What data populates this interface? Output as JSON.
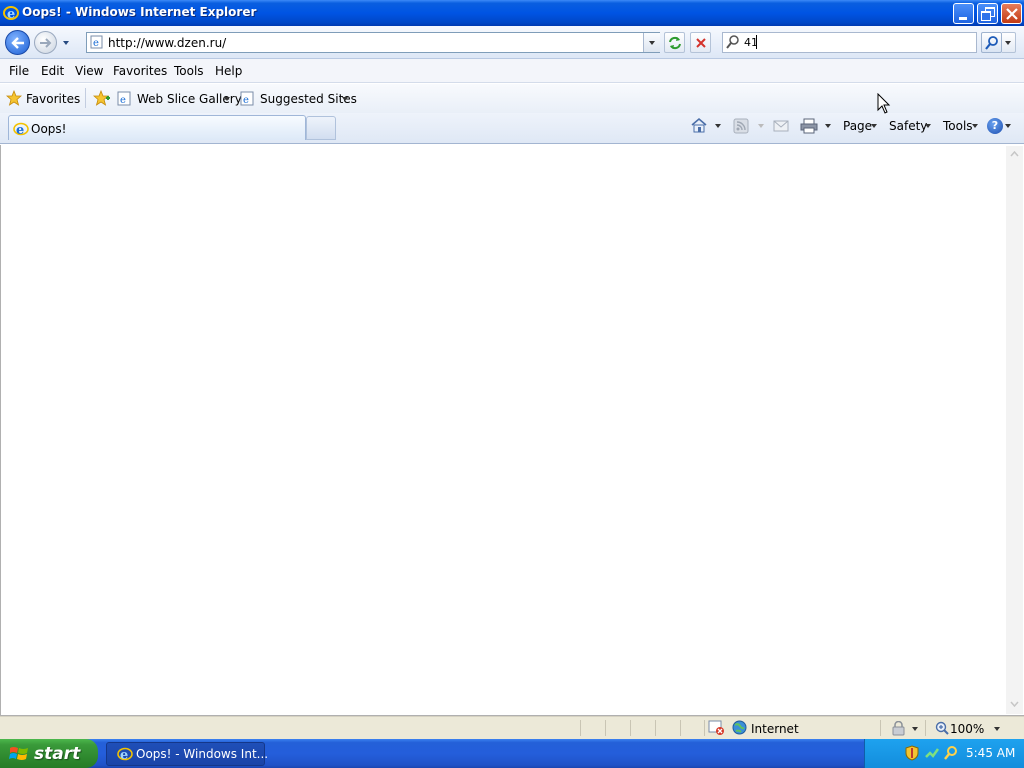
{
  "window": {
    "title": "Oops! - Windows Internet Explorer"
  },
  "address_bar": {
    "url": "http://www.dzen.ru/"
  },
  "search": {
    "value": "41"
  },
  "menu": [
    "File",
    "Edit",
    "View",
    "Favorites",
    "Tools",
    "Help"
  ],
  "favorites_bar": {
    "favorites_label": "Favorites",
    "web_slice_gallery": "Web Slice Gallery",
    "suggested_sites": "Suggested Sites"
  },
  "tabs": [
    {
      "label": "Oops!"
    }
  ],
  "command_bar": {
    "page": "Page",
    "safety": "Safety",
    "tools": "Tools"
  },
  "status_bar": {
    "zone": "Internet",
    "zoom": "100%"
  },
  "taskbar": {
    "start_label": "start",
    "window_button": "Oops! - Windows Int...",
    "clock": "5:45 AM"
  },
  "colors": {
    "titlebar_blue": "#0054e3",
    "taskbar_blue": "#245edb",
    "start_green": "#3a9a3a",
    "tray_blue": "#1ea2ef"
  }
}
